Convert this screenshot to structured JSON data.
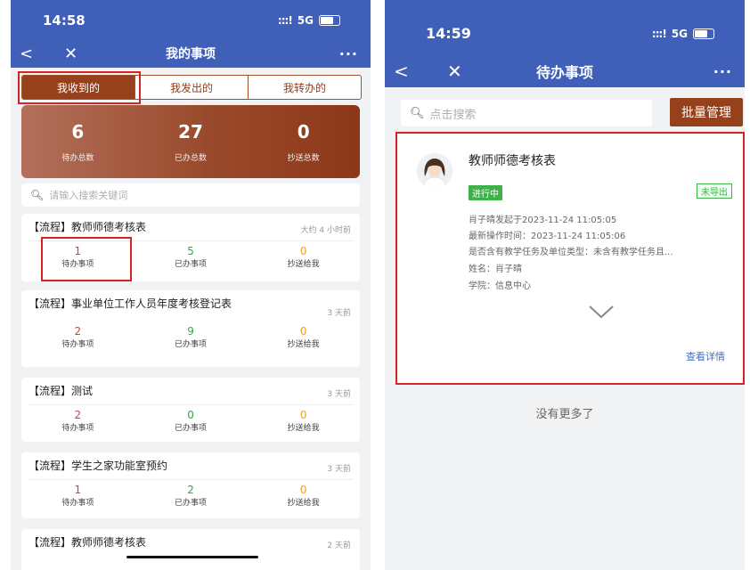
{
  "left": {
    "status_time": "14:58",
    "network": "5G",
    "title": "我的事项",
    "tabs": [
      "我收到的",
      "我发出的",
      "我转办的"
    ],
    "summary": [
      {
        "num": "6",
        "label": "待办总数"
      },
      {
        "num": "27",
        "label": "已办总数"
      },
      {
        "num": "0",
        "label": "抄送总数"
      }
    ],
    "search_placeholder": "请输入搜索关键词",
    "stat_labels": [
      "待办事项",
      "已办事项",
      "抄送给我"
    ],
    "cards": [
      {
        "title": "【流程】教师师德考核表",
        "time": "大约 4 小时前",
        "pending": "1",
        "done": "5",
        "cc": "0"
      },
      {
        "title": "【流程】事业单位工作人员年度考核登记表",
        "time": "3 天前",
        "pending": "2",
        "done": "9",
        "cc": "0"
      },
      {
        "title": "【流程】测试",
        "time": "3 天前",
        "pending": "2",
        "done": "0",
        "cc": "0"
      },
      {
        "title": "【流程】学生之家功能室预约",
        "time": "3 天前",
        "pending": "1",
        "done": "2",
        "cc": "0"
      },
      {
        "title": "【流程】教师师德考核表",
        "time": "2 天前"
      }
    ]
  },
  "right": {
    "status_time": "14:59",
    "network": "5G",
    "title": "待办事项",
    "search_placeholder": "点击搜索",
    "batch_button": "批量管理",
    "item": {
      "title": "教师师德考核表",
      "status_badge": "进行中",
      "export_badge": "未导出",
      "line1": "肖子晴发起于2023-11-24 11:05:05",
      "line2": "最新操作时间：2023-11-24 11:05:06",
      "line3": "是否含有教学任务及单位类型：未含有教学任务且...",
      "line4": "姓名：肖子晴",
      "line5": "学院：信息中心",
      "view_link": "查看详情"
    },
    "no_more": "没有更多了"
  },
  "colors": {
    "nav_blue": "#3f5fb8",
    "brand_brown": "#96401c",
    "highlight_red": "#d62424",
    "pending_red": "#e03b3b",
    "done_green": "#33a84a",
    "cc_orange": "#f0a020"
  }
}
